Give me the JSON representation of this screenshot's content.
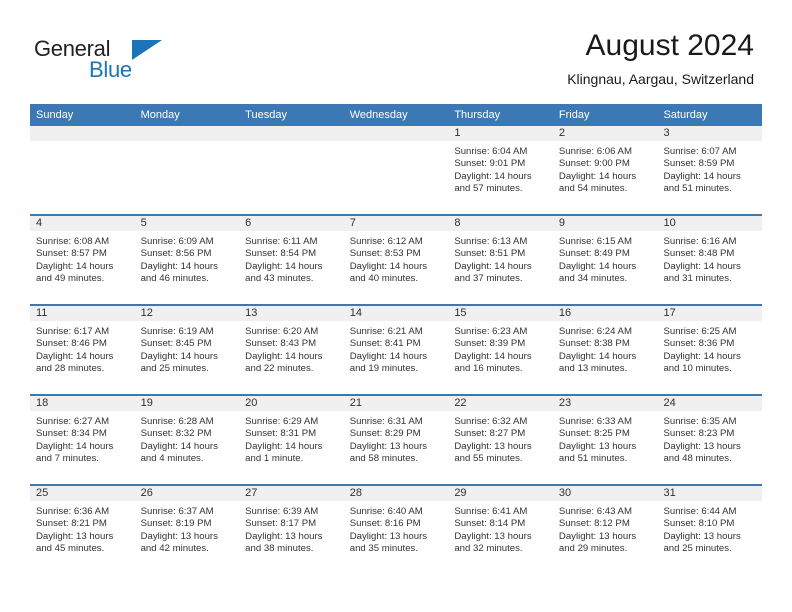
{
  "brand": {
    "name_dark": "General",
    "name_blue": "Blue",
    "accent_color": "#1b75bb"
  },
  "header": {
    "title": "August 2024",
    "subtitle": "Klingnau, Aargau, Switzerland",
    "header_bar_color": "#3b78b4"
  },
  "calendar": {
    "weekday_headers": [
      "Sunday",
      "Monday",
      "Tuesday",
      "Wednesday",
      "Thursday",
      "Friday",
      "Saturday"
    ],
    "weeks": [
      [
        {
          "day": "",
          "lines": []
        },
        {
          "day": "",
          "lines": []
        },
        {
          "day": "",
          "lines": []
        },
        {
          "day": "",
          "lines": []
        },
        {
          "day": "1",
          "lines": [
            "Sunrise: 6:04 AM",
            "Sunset: 9:01 PM",
            "Daylight: 14 hours",
            "and 57 minutes."
          ]
        },
        {
          "day": "2",
          "lines": [
            "Sunrise: 6:06 AM",
            "Sunset: 9:00 PM",
            "Daylight: 14 hours",
            "and 54 minutes."
          ]
        },
        {
          "day": "3",
          "lines": [
            "Sunrise: 6:07 AM",
            "Sunset: 8:59 PM",
            "Daylight: 14 hours",
            "and 51 minutes."
          ]
        }
      ],
      [
        {
          "day": "4",
          "lines": [
            "Sunrise: 6:08 AM",
            "Sunset: 8:57 PM",
            "Daylight: 14 hours",
            "and 49 minutes."
          ]
        },
        {
          "day": "5",
          "lines": [
            "Sunrise: 6:09 AM",
            "Sunset: 8:56 PM",
            "Daylight: 14 hours",
            "and 46 minutes."
          ]
        },
        {
          "day": "6",
          "lines": [
            "Sunrise: 6:11 AM",
            "Sunset: 8:54 PM",
            "Daylight: 14 hours",
            "and 43 minutes."
          ]
        },
        {
          "day": "7",
          "lines": [
            "Sunrise: 6:12 AM",
            "Sunset: 8:53 PM",
            "Daylight: 14 hours",
            "and 40 minutes."
          ]
        },
        {
          "day": "8",
          "lines": [
            "Sunrise: 6:13 AM",
            "Sunset: 8:51 PM",
            "Daylight: 14 hours",
            "and 37 minutes."
          ]
        },
        {
          "day": "9",
          "lines": [
            "Sunrise: 6:15 AM",
            "Sunset: 8:49 PM",
            "Daylight: 14 hours",
            "and 34 minutes."
          ]
        },
        {
          "day": "10",
          "lines": [
            "Sunrise: 6:16 AM",
            "Sunset: 8:48 PM",
            "Daylight: 14 hours",
            "and 31 minutes."
          ]
        }
      ],
      [
        {
          "day": "11",
          "lines": [
            "Sunrise: 6:17 AM",
            "Sunset: 8:46 PM",
            "Daylight: 14 hours",
            "and 28 minutes."
          ]
        },
        {
          "day": "12",
          "lines": [
            "Sunrise: 6:19 AM",
            "Sunset: 8:45 PM",
            "Daylight: 14 hours",
            "and 25 minutes."
          ]
        },
        {
          "day": "13",
          "lines": [
            "Sunrise: 6:20 AM",
            "Sunset: 8:43 PM",
            "Daylight: 14 hours",
            "and 22 minutes."
          ]
        },
        {
          "day": "14",
          "lines": [
            "Sunrise: 6:21 AM",
            "Sunset: 8:41 PM",
            "Daylight: 14 hours",
            "and 19 minutes."
          ]
        },
        {
          "day": "15",
          "lines": [
            "Sunrise: 6:23 AM",
            "Sunset: 8:39 PM",
            "Daylight: 14 hours",
            "and 16 minutes."
          ]
        },
        {
          "day": "16",
          "lines": [
            "Sunrise: 6:24 AM",
            "Sunset: 8:38 PM",
            "Daylight: 14 hours",
            "and 13 minutes."
          ]
        },
        {
          "day": "17",
          "lines": [
            "Sunrise: 6:25 AM",
            "Sunset: 8:36 PM",
            "Daylight: 14 hours",
            "and 10 minutes."
          ]
        }
      ],
      [
        {
          "day": "18",
          "lines": [
            "Sunrise: 6:27 AM",
            "Sunset: 8:34 PM",
            "Daylight: 14 hours",
            "and 7 minutes."
          ]
        },
        {
          "day": "19",
          "lines": [
            "Sunrise: 6:28 AM",
            "Sunset: 8:32 PM",
            "Daylight: 14 hours",
            "and 4 minutes."
          ]
        },
        {
          "day": "20",
          "lines": [
            "Sunrise: 6:29 AM",
            "Sunset: 8:31 PM",
            "Daylight: 14 hours",
            "and 1 minute."
          ]
        },
        {
          "day": "21",
          "lines": [
            "Sunrise: 6:31 AM",
            "Sunset: 8:29 PM",
            "Daylight: 13 hours",
            "and 58 minutes."
          ]
        },
        {
          "day": "22",
          "lines": [
            "Sunrise: 6:32 AM",
            "Sunset: 8:27 PM",
            "Daylight: 13 hours",
            "and 55 minutes."
          ]
        },
        {
          "day": "23",
          "lines": [
            "Sunrise: 6:33 AM",
            "Sunset: 8:25 PM",
            "Daylight: 13 hours",
            "and 51 minutes."
          ]
        },
        {
          "day": "24",
          "lines": [
            "Sunrise: 6:35 AM",
            "Sunset: 8:23 PM",
            "Daylight: 13 hours",
            "and 48 minutes."
          ]
        }
      ],
      [
        {
          "day": "25",
          "lines": [
            "Sunrise: 6:36 AM",
            "Sunset: 8:21 PM",
            "Daylight: 13 hours",
            "and 45 minutes."
          ]
        },
        {
          "day": "26",
          "lines": [
            "Sunrise: 6:37 AM",
            "Sunset: 8:19 PM",
            "Daylight: 13 hours",
            "and 42 minutes."
          ]
        },
        {
          "day": "27",
          "lines": [
            "Sunrise: 6:39 AM",
            "Sunset: 8:17 PM",
            "Daylight: 13 hours",
            "and 38 minutes."
          ]
        },
        {
          "day": "28",
          "lines": [
            "Sunrise: 6:40 AM",
            "Sunset: 8:16 PM",
            "Daylight: 13 hours",
            "and 35 minutes."
          ]
        },
        {
          "day": "29",
          "lines": [
            "Sunrise: 6:41 AM",
            "Sunset: 8:14 PM",
            "Daylight: 13 hours",
            "and 32 minutes."
          ]
        },
        {
          "day": "30",
          "lines": [
            "Sunrise: 6:43 AM",
            "Sunset: 8:12 PM",
            "Daylight: 13 hours",
            "and 29 minutes."
          ]
        },
        {
          "day": "31",
          "lines": [
            "Sunrise: 6:44 AM",
            "Sunset: 8:10 PM",
            "Daylight: 13 hours",
            "and 25 minutes."
          ]
        }
      ]
    ]
  }
}
